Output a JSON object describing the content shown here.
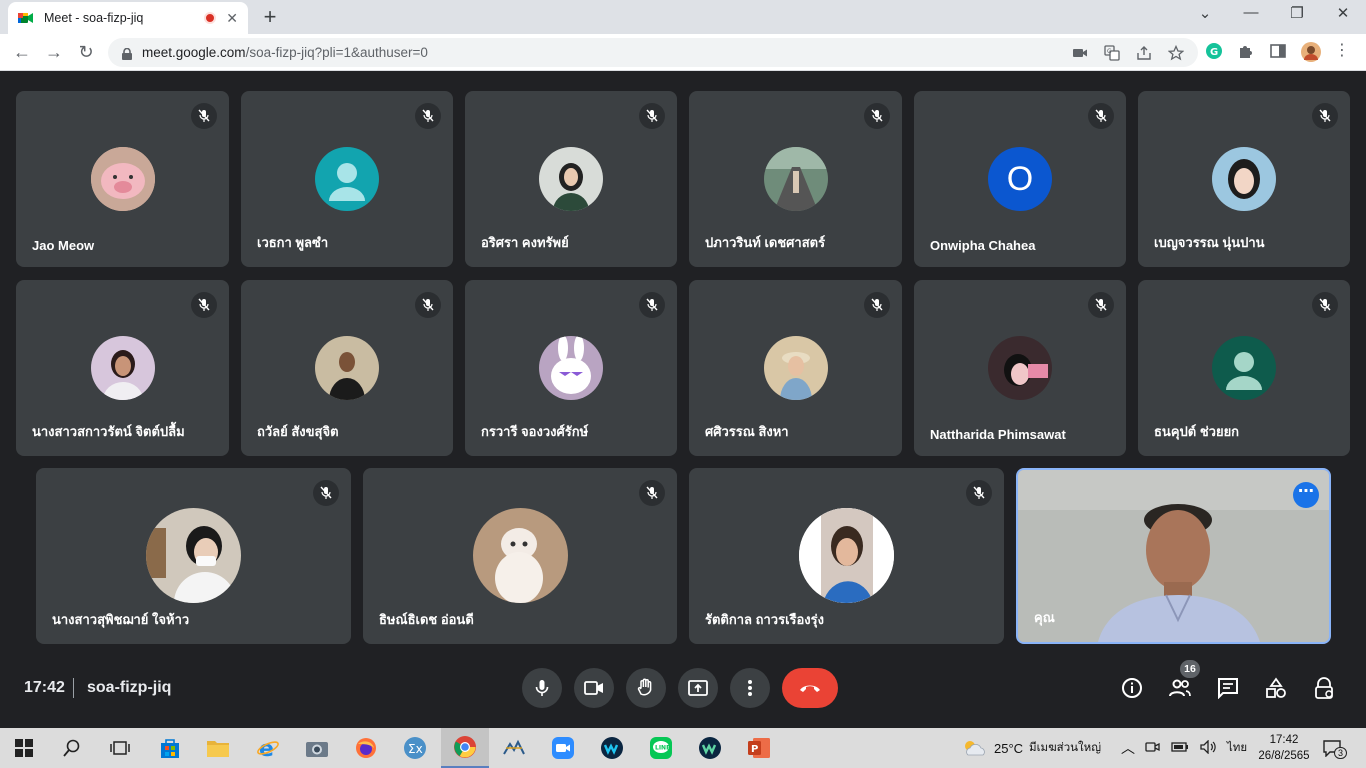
{
  "browser": {
    "tab_title": "Meet - soa-fizp-jiq",
    "url_host": "meet.google.com",
    "url_path": "/soa-fizp-jiq?pli=1&authuser=0"
  },
  "participants_row1": [
    {
      "name": "Jao Meow"
    },
    {
      "name": "เวธกา พูลซำ"
    },
    {
      "name": "อริศรา คงทรัพย์"
    },
    {
      "name": "ปภาวรินท์ เดชศาสตร์"
    },
    {
      "name": "Onwipha Chahea",
      "initial": "O"
    },
    {
      "name": "เบญจวรรณ นุ่นปาน"
    }
  ],
  "participants_row2": [
    {
      "name": "นางสาวสกาวรัตน์ จิตต์ปลื้ม"
    },
    {
      "name": "ถวัลย์ สังขสุจิต"
    },
    {
      "name": "กรวารี จองวงศ์รักษ์"
    },
    {
      "name": "ศศิวรรณ สิงหา"
    },
    {
      "name": "Nattharida Phimsawat"
    },
    {
      "name": "ธนคุปต์ ช่วยยก"
    }
  ],
  "participants_row3": [
    {
      "name": "นางสาวสุพิชฌาย์ ใจห้าว"
    },
    {
      "name": "ธิษณ์ธิเดช อ่อนดี"
    },
    {
      "name": "รัตติกาล ถาวรเรืองรุ่ง"
    },
    {
      "name": "คุณ"
    }
  ],
  "meeting": {
    "time": "17:42",
    "code": "soa-fizp-jiq",
    "participant_count": "16"
  },
  "taskbar": {
    "weather": "25°C",
    "weather_text": "มีเมฆส่วนใหญ่",
    "lang": "ไทย",
    "time": "17:42",
    "date": "26/8/2565",
    "notif_count": "3"
  }
}
